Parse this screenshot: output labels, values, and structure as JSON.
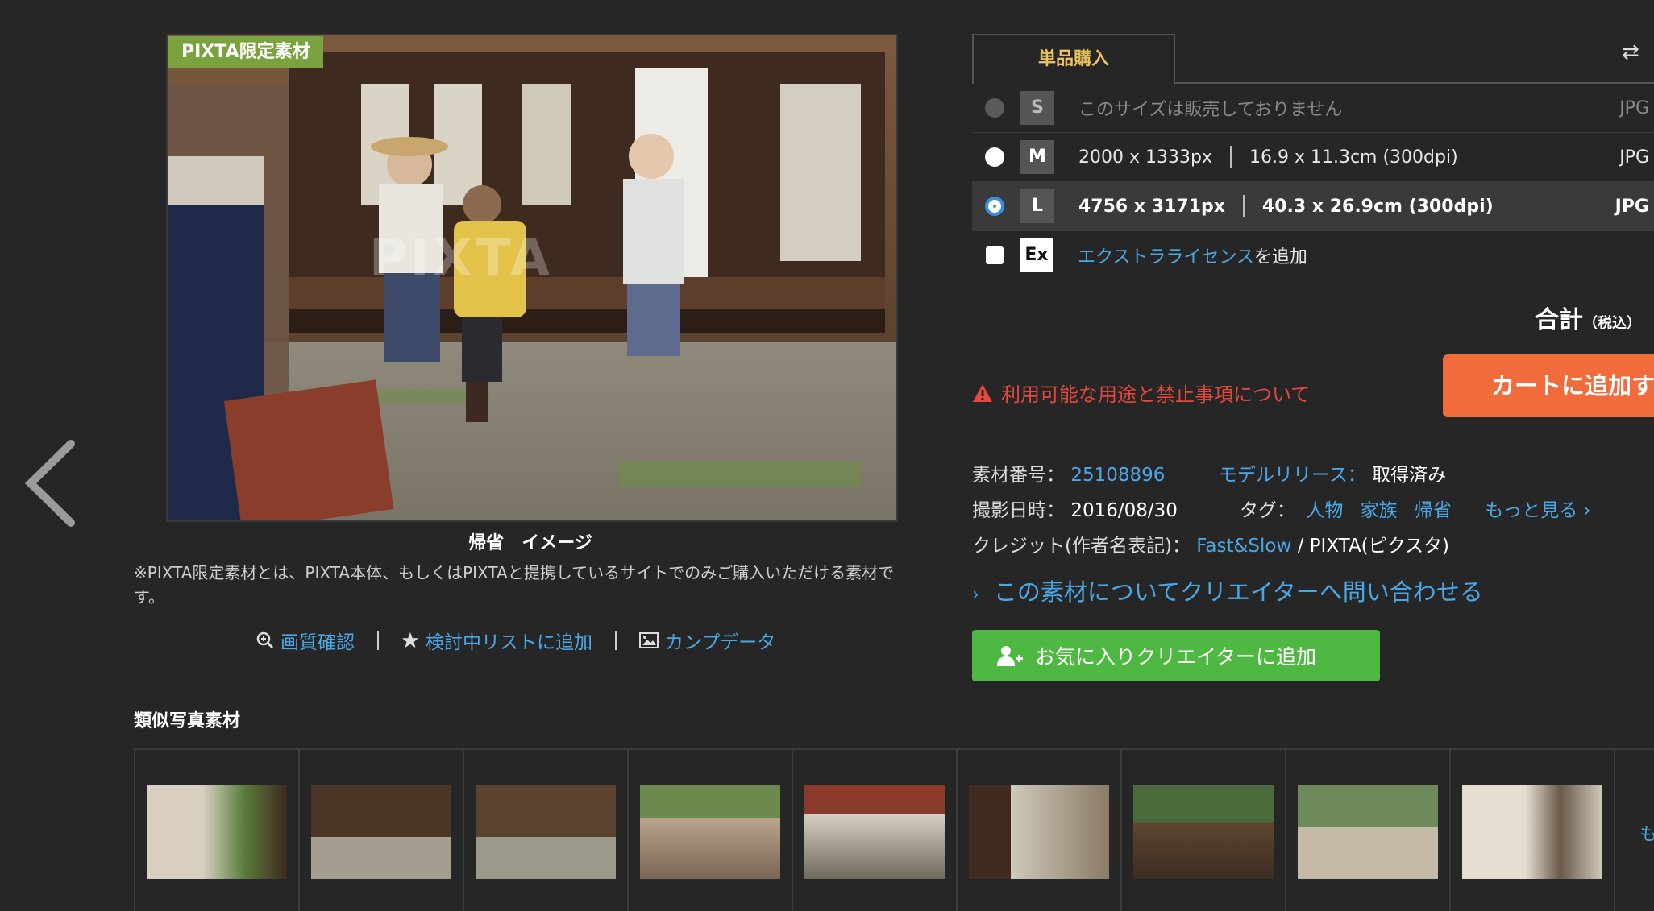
{
  "badge": "PIXTA限定素材",
  "caption": "帰省　イメージ",
  "note": "※PIXTA限定素材とは、PIXTA本体、もしくはPIXTAと提携しているサイトでのみご購入いただける素材です。",
  "watermark": "PIXTA",
  "actions": {
    "quality": "画質確認",
    "wishlist": "検討中リストに追加",
    "comp": "カンプデータ"
  },
  "similar_title": "類似写真素材",
  "more": "も",
  "tab": {
    "label": "単品購入"
  },
  "sizes": [
    {
      "code": "S",
      "text": "このサイズは販売しておりません",
      "fmt": "JPG"
    },
    {
      "code": "M",
      "px": "2000 x 1333px",
      "cm": "16.9 x 11.3cm (300dpi)",
      "fmt": "JPG"
    },
    {
      "code": "L",
      "px": "4756 x 3171px",
      "cm": "40.3 x 26.9cm (300dpi)",
      "fmt": "JPG"
    }
  ],
  "extra": {
    "code": "Ex",
    "link": "エクストラライセンス",
    "suffix": "を追加"
  },
  "total": {
    "label": "合計",
    "tax": "（税込）"
  },
  "warning": "利用可能な用途と禁止事項について",
  "cart_button": "カートに追加す",
  "info": {
    "id_label": "素材番号：",
    "id_value": "25108896",
    "model_label": "モデルリリース：",
    "model_value": "取得済み",
    "date_label": "撮影日時：",
    "date_value": "2016/08/30",
    "tag_label": "タグ：",
    "tags": [
      "人物",
      "家族",
      "帰省"
    ],
    "more_tags": "もっと見る",
    "credit_label": "クレジット(作者名表記)：",
    "credit_author": "Fast&Slow",
    "credit_slash": " / ",
    "credit_site": "PIXTA(ピクスタ)"
  },
  "contact_link": "この素材についてクリエイターへ問い合わせる",
  "fav_button": "お気に入りクリエイターに追加",
  "colors": {
    "accent_link": "#4aa8e6",
    "cart": "#f26b3a",
    "fav": "#4fb843",
    "badge": "#7aa23e",
    "warning": "#e0493c"
  }
}
